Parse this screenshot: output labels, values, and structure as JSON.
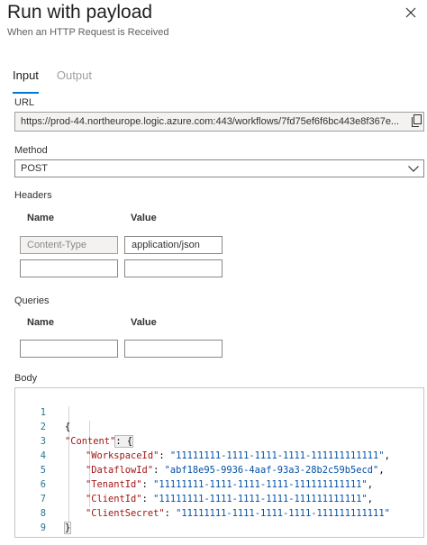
{
  "panel": {
    "title": "Run with payload",
    "subtitle": "When an HTTP Request is Received"
  },
  "tabs": [
    {
      "label": "Input",
      "active": true
    },
    {
      "label": "Output",
      "active": false
    }
  ],
  "url": {
    "label": "URL",
    "value": "https://prod-44.northeurope.logic.azure.com:443/workflows/7fd75ef6f6bc443e8f367e..."
  },
  "method": {
    "label": "Method",
    "selected": "POST"
  },
  "headers": {
    "label": "Headers",
    "name_col": "Name",
    "value_col": "Value",
    "rows": [
      {
        "name": "Content-Type",
        "value": "application/json"
      },
      {
        "name": "",
        "value": ""
      }
    ]
  },
  "queries": {
    "label": "Queries",
    "name_col": "Name",
    "value_col": "Value",
    "rows": [
      {
        "name": "",
        "value": ""
      }
    ]
  },
  "body": {
    "label": "Body",
    "line_numbers": [
      "1",
      "2",
      "3",
      "4",
      "5",
      "6",
      "7",
      "8",
      "9"
    ],
    "lines": {
      "l1": "{",
      "l2_key": "\"Content\"",
      "l2_rest": ": {",
      "l3_key": "\"WorkspaceId\"",
      "l3_val": "\"11111111-1111-1111-1111-111111111111\"",
      "l4_key": "\"DataflowId\"",
      "l4_val": "\"abf18e95-9936-4aaf-93a3-28b2c59b5ecd\"",
      "l5_key": "\"TenantId\"",
      "l5_val": "\"11111111-1111-1111-1111-111111111111\"",
      "l6_key": "\"ClientId\"",
      "l6_val": "\"11111111-1111-1111-1111-111111111111\"",
      "l7_key": "\"ClientSecret\"",
      "l7_val": "\"11111111-1111-1111-1111-111111111111\"",
      "l8": "}",
      "l9": "}"
    }
  },
  "colors": {
    "accent": "#0078d4",
    "json_key": "#a31515",
    "json_string": "#0451a5",
    "line_number": "#237893"
  },
  "icons": [
    "close-icon",
    "copy-icon",
    "chevron-down-icon"
  ]
}
